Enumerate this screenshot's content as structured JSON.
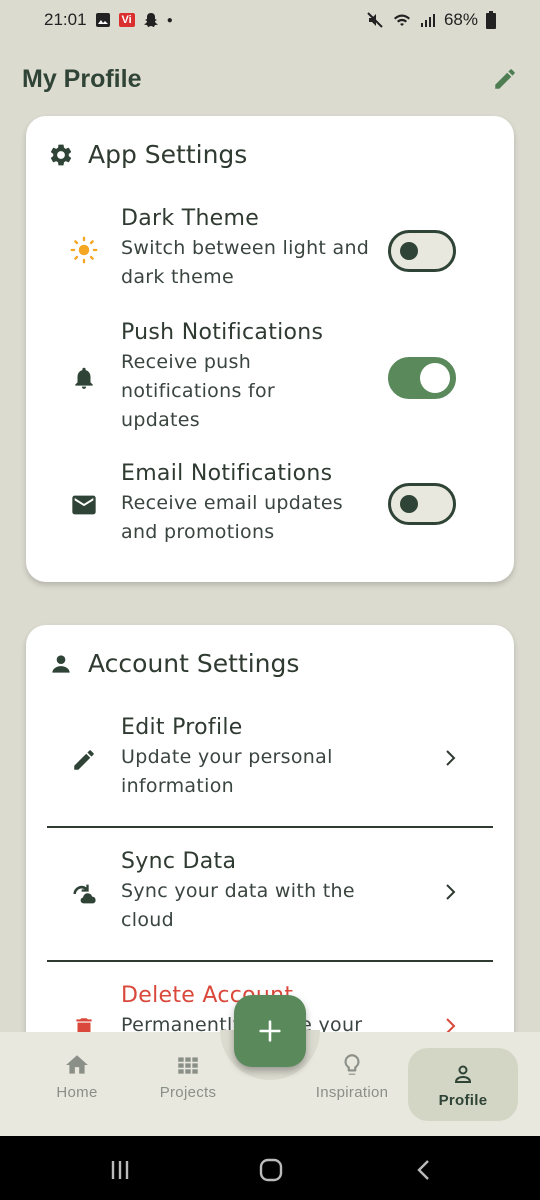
{
  "status_bar": {
    "time": "21:01",
    "vi_badge": "Vi",
    "battery": "68%"
  },
  "header": {
    "title": "My Profile"
  },
  "app_settings": {
    "title": "App Settings",
    "items": [
      {
        "title": "Dark Theme",
        "description": "Switch between light and dark theme",
        "icon": "sun-icon",
        "enabled": false
      },
      {
        "title": "Push Notifications",
        "description": "Receive push notifications for updates",
        "icon": "bell-icon",
        "enabled": true
      },
      {
        "title": "Email Notifications",
        "description": "Receive email updates and promotions",
        "icon": "mail-icon",
        "enabled": false
      }
    ]
  },
  "account_settings": {
    "title": "Account Settings",
    "items": [
      {
        "title": "Edit Profile",
        "description": "Update your personal information",
        "icon": "pencil-icon"
      },
      {
        "title": "Sync Data",
        "description": "Sync your data with the cloud",
        "icon": "cloud-sync-icon"
      },
      {
        "title": "Delete Account",
        "description": "Permanently delete your",
        "icon": "trash-icon"
      }
    ]
  },
  "bottom_nav": {
    "items": [
      {
        "label": "Home",
        "icon": "home-icon"
      },
      {
        "label": "Projects",
        "icon": "grid-icon"
      },
      {
        "label": "Inspiration",
        "icon": "lightbulb-icon"
      },
      {
        "label": "Profile",
        "icon": "person-icon",
        "active": true
      }
    ],
    "fab_icon": "plus-icon"
  },
  "colors": {
    "background": "#dcdbd0",
    "accent_green": "#5a8a5c",
    "dark_green": "#2f4436",
    "danger": "#d9483b",
    "sun": "#f5a623"
  }
}
